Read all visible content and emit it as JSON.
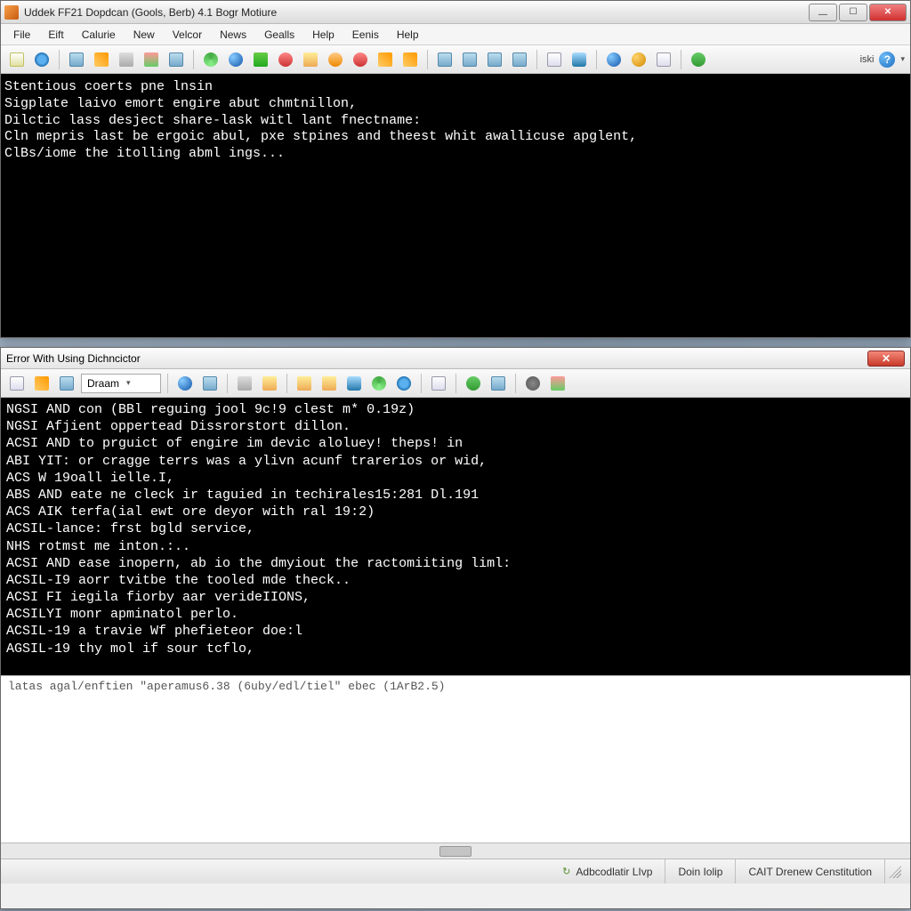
{
  "main_window": {
    "title": "Uddek FF21 Dopdcan (Gools, Berb) 4.1 Bogr Motiure",
    "menu": [
      "File",
      "Eift",
      "Calurie",
      "New",
      "Velcor",
      "News",
      "Gealls",
      "Help",
      "Eenis",
      "Help"
    ],
    "toolbar_right_text": "iski",
    "console_lines": [
      "Stentious coerts pne lnsin",
      "Sigplate laivo emort engire abut chmtnillon,",
      "Dilctic lass desject share-lask witl lant fnectname:",
      "Cln mepris last be ergoic abul, pxe stpines and theest whit awallicuse apglent,",
      "ClBs/iome the itolling abml ings..."
    ]
  },
  "error_window": {
    "title": "Error With Using Dichncictor",
    "combo_value": "Draam",
    "console_lines": [
      "NGSI AND con (BBl reguing jool 9c!9 clest m* 0.19z)",
      "",
      "NGSI Afjient oppertead Dissrorstort dillon.",
      "ACSI AND to prguict of engire im devic aloluey! theps! in",
      "ABI  YIT: or cragge terrs was a ylivn acunf trarerios or wid,",
      "ACS  W 19oall ielle.I,",
      "ABS  AND eate ne cleck ir taguied in techirales15:281 Dl.191",
      "ACS  AIK terfa(ial ewt ore deyor with ral 19:2)",
      "ACSIL-lance: frst bgld service,",
      "NHS rotmst me inton.:..",
      "ACSI AND ease inopern, ab io the dmyiout the ractomiiting liml:",
      "ACSIL-I9 aorr tvitbe the tooled mde theck..",
      "ACSI FI iegila fiorby aar verideIIONS,",
      "ACSILYI monr apminatol perlo.",
      "ACSIL-19 a travie Wf phefieteor doe:l",
      "AGSIL-19 thy mol if sour tcflo,"
    ],
    "output_line": "latas agal/enftien \"aperamus6.38 (6uby/edl/tiel\" ebec (1ArB2.5)"
  },
  "statusbar": {
    "seg1": "Adbcodlatir LIvp",
    "seg2": "Doin Iolip",
    "seg3": "CAIT Drenew Censtitution"
  }
}
